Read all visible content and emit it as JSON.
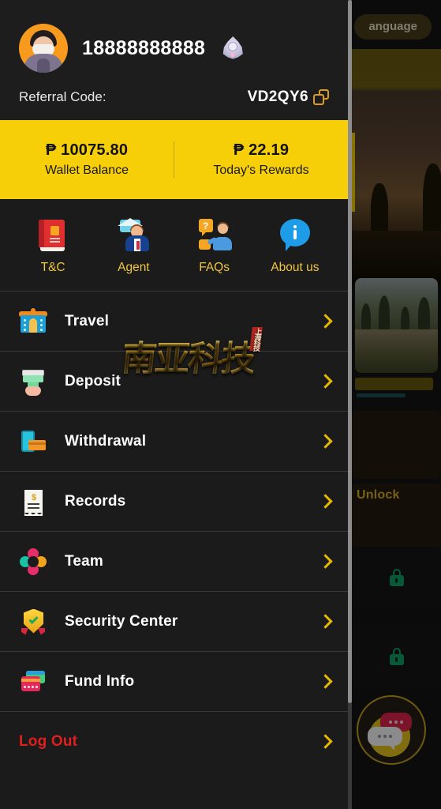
{
  "background": {
    "language_button": "anguage",
    "unlock_label": "Unlock",
    "lock_icon_a": "lock-icon",
    "lock_icon_b": "lock-icon",
    "chat_fab": "chat-support-icon"
  },
  "account": {
    "avatar": "user-avatar",
    "phone": "18888888888",
    "vip_badge": "vip-crown-badge",
    "referral_label": "Referral Code:",
    "referral_code": "VD2QY6",
    "copy_icon": "copy-icon"
  },
  "balance": {
    "wallet_amount": "₱ 10075.80",
    "wallet_label": "Wallet Balance",
    "rewards_amount": "₱ 22.19",
    "rewards_label": "Today's Rewards",
    "bar_color": "#f7cf08"
  },
  "quick_actions": [
    {
      "label": "T&C",
      "icon": "book-icon"
    },
    {
      "label": "Agent",
      "icon": "agent-icon"
    },
    {
      "label": "FAQs",
      "icon": "faq-icon"
    },
    {
      "label": "About us",
      "icon": "info-icon"
    }
  ],
  "menu": [
    {
      "label": "Travel",
      "icon": "temple-icon",
      "danger": false
    },
    {
      "label": "Deposit",
      "icon": "deposit-icon",
      "danger": false
    },
    {
      "label": "Withdrawal",
      "icon": "withdraw-icon",
      "danger": false
    },
    {
      "label": "Records",
      "icon": "receipt-icon",
      "danger": false
    },
    {
      "label": "Team",
      "icon": "team-icon",
      "danger": false
    },
    {
      "label": "Security Center",
      "icon": "shield-icon",
      "danger": false
    },
    {
      "label": "Fund Info",
      "icon": "cards-icon",
      "danger": false
    },
    {
      "label": "Log Out",
      "icon": "none",
      "danger": true
    }
  ],
  "watermark": {
    "text": "南亚科技",
    "seal": "上海科技"
  },
  "colors": {
    "accent_gold": "#f7cf08",
    "chevron_gold": "#e6b800",
    "danger_red": "#e01f1f",
    "drawer_bg": "#1b1b1b",
    "quick_label": "#f0c542"
  }
}
